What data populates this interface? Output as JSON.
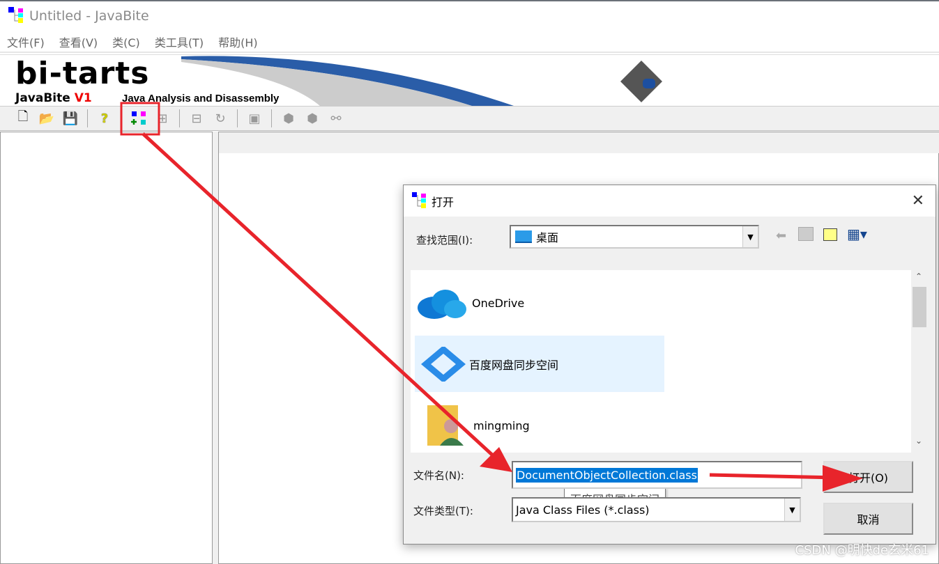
{
  "window": {
    "title": "Untitled - JavaBite"
  },
  "menu": [
    "文件(F)",
    "查看(V)",
    "类(C)",
    "类工具(T)",
    "帮助(H)"
  ],
  "banner": {
    "logo": "bi-tarts",
    "product": "JavaBite",
    "version": "V1",
    "tagline": "Java Analysis and Disassembly"
  },
  "toolbar": [
    "new-file-icon",
    "open-folder-icon",
    "save-icon",
    "help-icon",
    "add-class-icon",
    "class-tree-icon",
    "class-compare-icon",
    "class-refresh-icon",
    "class-save-icon",
    "inject-icon",
    "inject2-icon",
    "link-icon"
  ],
  "dialog": {
    "title": "打开",
    "look_in_label": "查找范围(I):",
    "look_in_value": "桌面",
    "items": [
      {
        "name": "OneDrive"
      },
      {
        "name": "百度网盘同步空间",
        "selected": true
      },
      {
        "name": "mingming"
      }
    ],
    "tooltip": "百度网盘同步空间",
    "filename_label": "文件名(N):",
    "filename_value": "DocumentObjectCollection.class",
    "filetype_label": "文件类型(T):",
    "filetype_value": "Java Class Files (*.class)",
    "open_label": "打开(O)",
    "cancel_label": "取消"
  },
  "watermark": "CSDN @明快de玄米61",
  "colors": {
    "annotation": "#e8242b",
    "selection": "#0078d7",
    "selected_item": "#e5f3ff"
  }
}
